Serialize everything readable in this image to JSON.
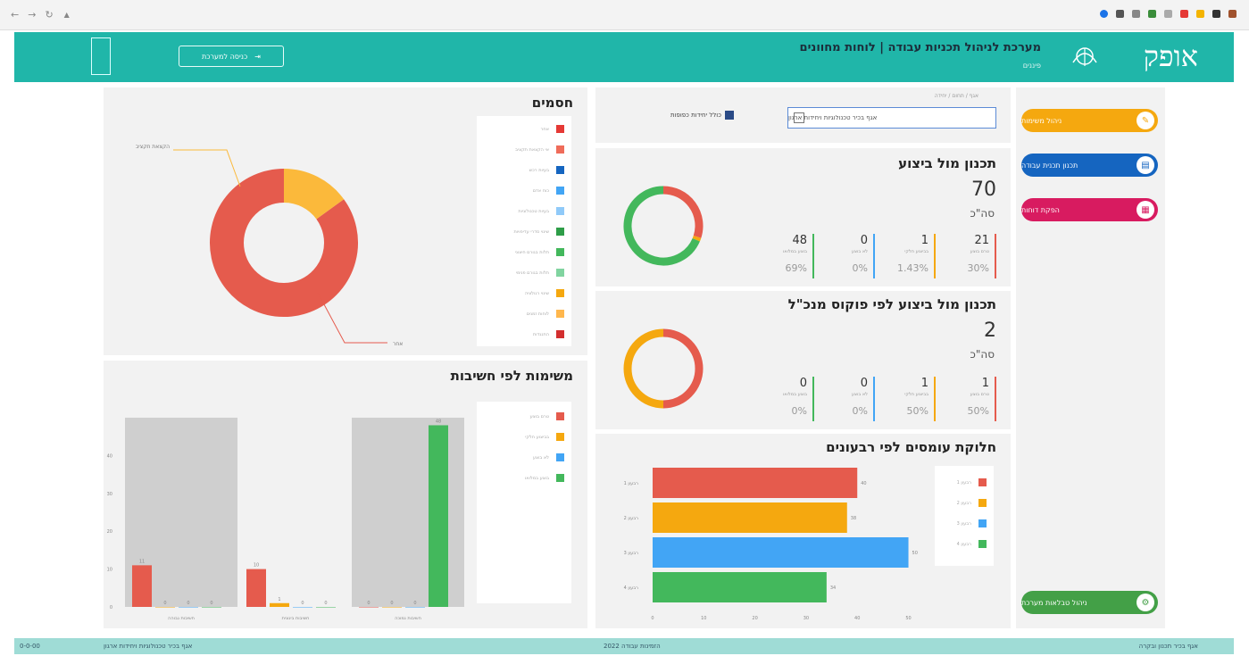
{
  "header": {
    "brand": "אופק",
    "title": "מערכת לניהול תכניות עבודה | לוחות מחוונים",
    "subtitle": "פיננים",
    "login_label": "כניסה למערכת"
  },
  "sidebar": {
    "items": [
      {
        "label": "ניהול משימות",
        "color": "#f5a80f"
      },
      {
        "label": "תכנון תכנית עבודה",
        "color": "#1565c0"
      },
      {
        "label": "הפקת דוחות",
        "color": "#d81b60"
      },
      {
        "label": "ניהול טבלאות מערכת",
        "color": "#43a047"
      }
    ]
  },
  "filters": {
    "group_label": "אגף / תחום / יחידה",
    "dropdown_value": "אגף בכיר טכנולוגיות ויחידות ארגון",
    "checkbox_label": "כולל יחידות כפופות"
  },
  "plan_vs_exec": {
    "title": "תכנון מול ביצוע",
    "total": "70",
    "total_label": "סה\"כ",
    "metrics": [
      {
        "value": "21",
        "label": "טרם בוצע",
        "pct": "30%",
        "color": "#e55b4d"
      },
      {
        "value": "1",
        "label": "בביצוע חלקי",
        "pct": "1.43%",
        "color": "#f5a80f"
      },
      {
        "value": "0",
        "label": "לא בוצע",
        "pct": "0%",
        "color": "#42a5f5"
      },
      {
        "value": "48",
        "label": "בוצע במלואו",
        "pct": "69%",
        "color": "#43b85c"
      }
    ]
  },
  "plan_vs_exec_focus": {
    "title": "תכנון מול ביצוע לפי פוקוס מנכ\"ל",
    "total": "2",
    "total_label": "סה\"כ",
    "metrics": [
      {
        "value": "1",
        "label": "טרם בוצע",
        "pct": "50%",
        "color": "#e55b4d"
      },
      {
        "value": "1",
        "label": "בביצוע חלקי",
        "pct": "50%",
        "color": "#f5a80f"
      },
      {
        "value": "0",
        "label": "לא בוצע",
        "pct": "0%",
        "color": "#42a5f5"
      },
      {
        "value": "0",
        "label": "בוצע במלואו",
        "pct": "0%",
        "color": "#43b85c"
      }
    ]
  },
  "budget": {
    "title": "חסמים",
    "legend": [
      {
        "label": "אחר",
        "color": "#e53935"
      },
      {
        "label": "אי הקצאת תקציב",
        "color": "#ef6c5a"
      },
      {
        "label": "בעיות רכש",
        "color": "#1565c0"
      },
      {
        "label": "כוח אדם",
        "color": "#42a5f5"
      },
      {
        "label": "בעיות טכנולוגיות",
        "color": "#90caf9"
      },
      {
        "label": "שינוי סדרי עדיפויות",
        "color": "#2e9d48"
      },
      {
        "label": "תלות בגורם חיצוני",
        "color": "#43b85c"
      },
      {
        "label": "תלות בגורם פנימי",
        "color": "#81d4a0"
      },
      {
        "label": "שינוי רגולציה",
        "color": "#f5a80f"
      },
      {
        "label": "לוחות זמנים",
        "color": "#ffb74d"
      },
      {
        "label": "התנגדות",
        "color": "#d32f2f"
      }
    ],
    "callout_top": "הקצאת תקציב",
    "callout_bottom": "אחר"
  },
  "priority": {
    "title": "משימות לפי חשיבות",
    "legend": [
      {
        "label": "טרם בוצע",
        "color": "#e55b4d"
      },
      {
        "label": "בביצוע חלקי",
        "color": "#f5a80f"
      },
      {
        "label": "לא בוצע",
        "color": "#42a5f5"
      },
      {
        "label": "בוצע במלואו",
        "color": "#43b85c"
      }
    ],
    "groups": [
      "חשיבות גבוהה",
      "חשיבות בינונית",
      "חשיבות נמוכה"
    ]
  },
  "quarters": {
    "title": "חלוקת עומסים לפי רבעונים",
    "legend": [
      {
        "label": "רבעון 1",
        "color": "#e55b4d"
      },
      {
        "label": "רבעון 2",
        "color": "#f5a80f"
      },
      {
        "label": "רבעון 3",
        "color": "#42a5f5"
      },
      {
        "label": "רבעון 4",
        "color": "#43b85c"
      }
    ]
  },
  "footer": {
    "left_code": "0-0-00",
    "left_text": "אגף בכיר טכנולוגיות ויחידות ארגון",
    "center_text": "הזמינות עבודה 2022",
    "right_text": "אגף בכיר תכנון ובקרה"
  },
  "chart_data": [
    {
      "type": "pie",
      "title": "תכנון מול ביצוע",
      "categories": [
        "טרם בוצע",
        "בביצוע חלקי",
        "לא בוצע",
        "בוצע במלואו"
      ],
      "values": [
        21,
        1,
        0,
        48
      ]
    },
    {
      "type": "pie",
      "title": "תכנון מול ביצוע לפי פוקוס מנכ\"ל",
      "categories": [
        "טרם בוצע",
        "בביצוע חלקי",
        "לא בוצע",
        "בוצע במלואו"
      ],
      "values": [
        1,
        1,
        0,
        0
      ]
    },
    {
      "type": "pie",
      "title": "חסמים",
      "categories": [
        "אחר",
        "הקצאת תקציב"
      ],
      "values": [
        85,
        15
      ]
    },
    {
      "type": "bar",
      "title": "משימות לפי חשיבות",
      "categories": [
        "חשיבות גבוהה",
        "חשיבות בינונית",
        "חשיבות נמוכה"
      ],
      "series": [
        {
          "name": "טרם בוצע",
          "values": [
            11,
            10,
            0
          ]
        },
        {
          "name": "בביצוע חלקי",
          "values": [
            0,
            1,
            0
          ]
        },
        {
          "name": "לא בוצע",
          "values": [
            0,
            0,
            0
          ]
        },
        {
          "name": "בוצע במלואו",
          "values": [
            0,
            0,
            48
          ]
        }
      ],
      "ylim": [
        0,
        50
      ],
      "yticks": [
        0,
        10,
        20,
        30,
        40
      ]
    },
    {
      "type": "bar",
      "title": "חלוקת עומסים לפי רבעונים",
      "orientation": "horizontal",
      "categories": [
        "רבעון 1",
        "רבעון 2",
        "רבעון 3",
        "רבעון 4"
      ],
      "values": [
        40,
        38,
        50,
        34
      ],
      "xlim": [
        0,
        52
      ],
      "xticks": [
        0,
        10,
        20,
        30,
        40,
        50
      ]
    }
  ]
}
